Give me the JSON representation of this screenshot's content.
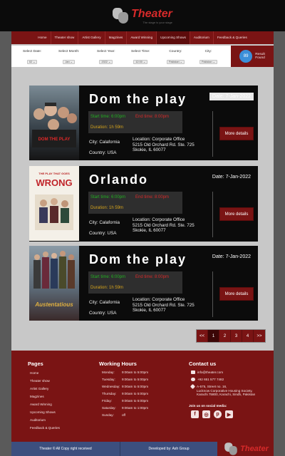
{
  "brand": {
    "name": "Theater",
    "tagline": "The stage is your stage"
  },
  "nav": {
    "items": [
      "Home",
      "Theater show",
      "Artist Gallery",
      "Magzines",
      "Award Winning",
      "Upcoming Shows",
      "Auditorium",
      "Feedback & Queries"
    ],
    "active": "Upcoming Shows"
  },
  "filters": {
    "date_label": "Select Date:",
    "date_value": "02",
    "month_label": "Select Month:",
    "month_value": "Jan",
    "year_label": "Select Year:",
    "year_value": "2022",
    "time_label": "Select Time:",
    "time_value": "12:00",
    "country_label": "Country:",
    "country_value": "Pakistan",
    "city_label": "City:",
    "city_value": "Pakistan",
    "result_count": "89",
    "result_label_1": "Result",
    "result_label_2": "Found"
  },
  "shows": [
    {
      "title": "Dom the play",
      "date": "Date: 7-Jan-2022",
      "start": "Start time: 6:00pm",
      "end": "End time: 8:00pm",
      "duration": "Duration: 1h 59m",
      "city": "City: Calafornia",
      "country": "Country: USA",
      "location_1": "Location: Corporate Office",
      "location_2": "5215 Old Orchard Rd. Ste. 725",
      "location_3": "Skokie, IL 60077",
      "button": "More details",
      "poster_title": "DOM THE PLAY"
    },
    {
      "title": "Orlando",
      "date": "Date: 7-Jan-2022",
      "start": "Start time: 6:00pm",
      "end": "End time: 8:00pm",
      "duration": "Duration: 1h 59m",
      "city": "City: Calafornia",
      "country": "Country: USA",
      "location_1": "Location: Corporate Office",
      "location_2": "5215 Old Orchard Rd. Ste. 725",
      "location_3": "Skokie, IL 60077",
      "button": "More details",
      "poster_top": "THE PLAY THAT GOES",
      "poster_title": "WRONG"
    },
    {
      "title": "Dom the play",
      "date": "Date: 7-Jan-2022",
      "start": "Start time: 6:00pm",
      "end": "End time: 8:00pm",
      "duration": "Duration: 1h 59m",
      "city": "City: Calafornia",
      "country": "Country: USA",
      "location_1": "Location: Corporate Office",
      "location_2": "5215 Old Orchard Rd. Ste. 725",
      "location_3": "Skokie, IL 60077",
      "button": "More details",
      "poster_title": "Austentatious"
    }
  ],
  "pagination": {
    "prev": "<<",
    "pages": [
      "1",
      "2",
      "3",
      "4"
    ],
    "active": "1",
    "next": ">>"
  },
  "footer": {
    "pages_heading": "Pages",
    "pages": [
      "Home",
      "Theater show",
      "Artist Gallery",
      "Magzines",
      "Award Winning",
      "Upcoming Shows",
      "Auditorium",
      "Feedback & Queries"
    ],
    "hours_heading": "Working Hours",
    "hours": [
      {
        "day": "Monday:",
        "time": "9:00am to 5:00pm"
      },
      {
        "day": "Tuesday:",
        "time": "9:00am to 5:00pm"
      },
      {
        "day": "Wednesday:",
        "time": "9:00am to 5:00pm"
      },
      {
        "day": "Thursday:",
        "time": "9:00am to 5:00pm"
      },
      {
        "day": "Friday:",
        "time": "9:00am to 5:00pm"
      },
      {
        "day": "Saturday:",
        "time": "9:00am to 1:00pm"
      },
      {
        "day": "Sunday:",
        "time": "off"
      }
    ],
    "contact_heading": "Contact us",
    "email": "info@theater.com",
    "phone": "+92 651 577 7482",
    "address_1": "A-575, Street no. 16,",
    "address_2": "Lucknow Corporative Housing Society,",
    "address_3": "Karachi 75800, Karachi, Sindh, Pakistan",
    "social_label": "Join us on social media:",
    "copyright": "Theater © All Copy right received",
    "developer": "Developed by: Ash Group"
  }
}
